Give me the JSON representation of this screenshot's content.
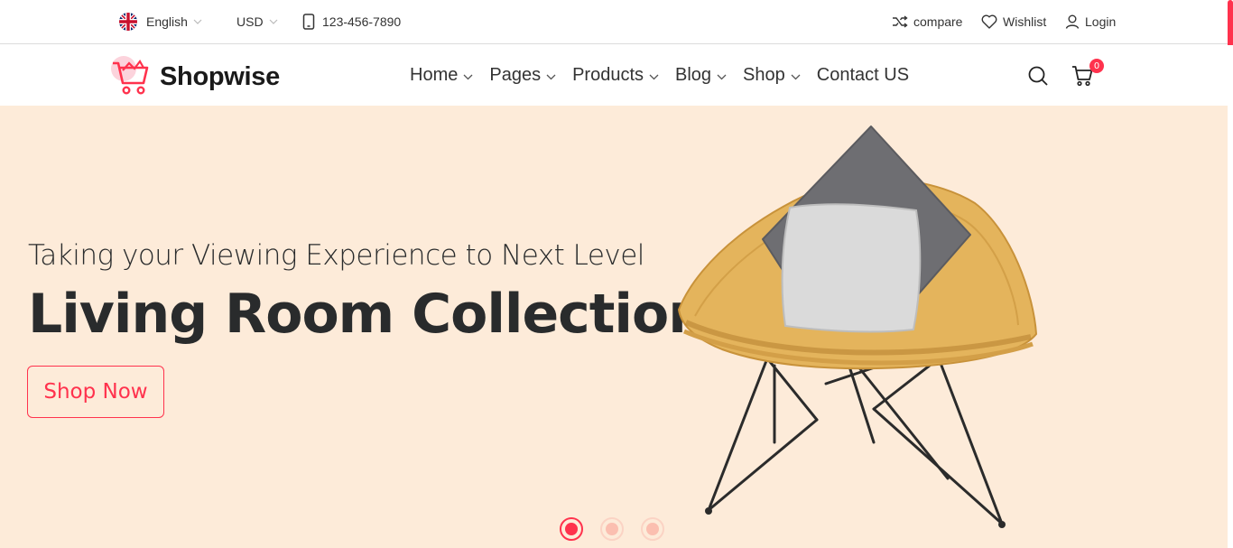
{
  "topbar": {
    "language": "English",
    "currency": "USD",
    "phone": "123-456-7890",
    "compare_label": "compare",
    "wishlist_label": "Wishlist",
    "login_label": "Login"
  },
  "header": {
    "brand": "Shopwise",
    "nav": [
      {
        "label": "Home"
      },
      {
        "label": "Pages"
      },
      {
        "label": "Products"
      },
      {
        "label": "Blog"
      },
      {
        "label": "Shop"
      },
      {
        "label": "Contact US"
      }
    ],
    "cart_count": "0"
  },
  "hero": {
    "subtitle": "Taking your Viewing Experience to Next Level",
    "title": "Living Room Collection",
    "cta_label": "Shop Now",
    "slide_count": 3,
    "active_slide": 1
  },
  "colors": {
    "accent": "#ff324d",
    "hero_background": "#fdebd9",
    "text": "#292b2c"
  },
  "icons": [
    "uk-flag-icon",
    "chevron-down-icon",
    "mobile-phone-icon",
    "shuffle-icon",
    "heart-icon",
    "user-icon",
    "search-icon",
    "cart-icon",
    "logo-cart-icon"
  ]
}
